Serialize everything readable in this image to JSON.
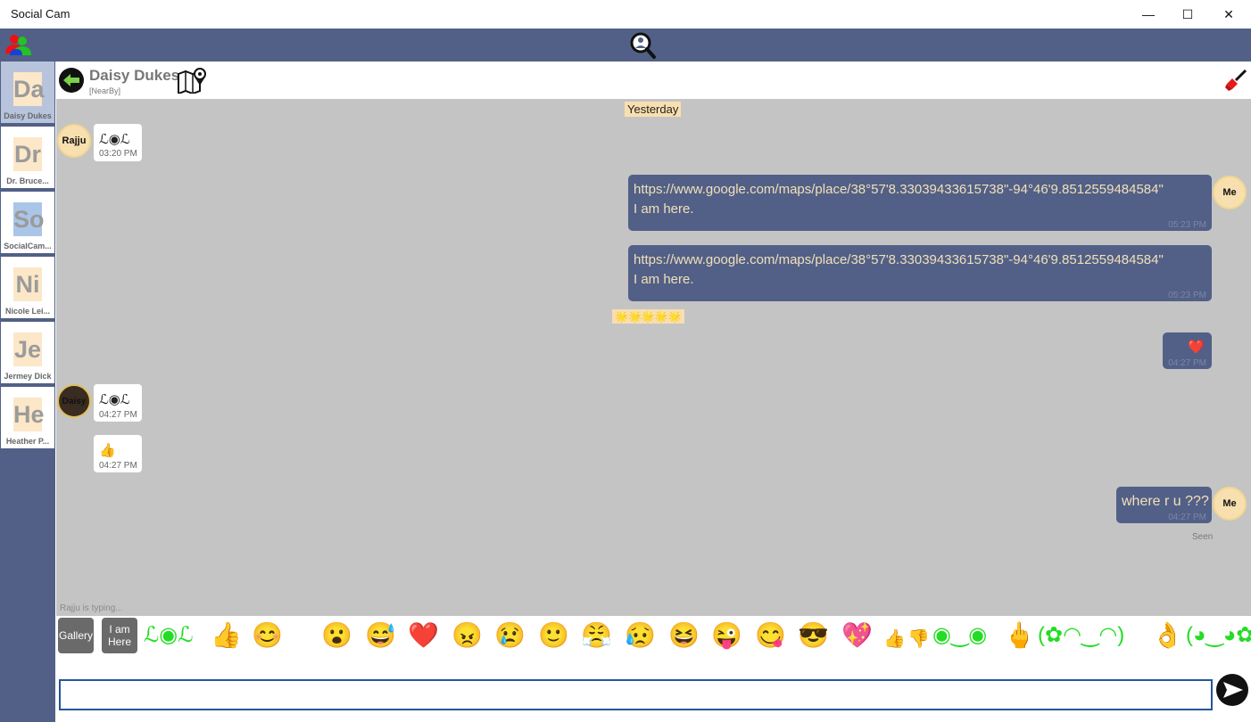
{
  "window": {
    "title": "Social Cam",
    "minimize": "—",
    "maximize": "☐",
    "close": "✕"
  },
  "sidebar": {
    "contacts": [
      {
        "initials": "Da",
        "name": "Daisy Dukes"
      },
      {
        "initials": "Dr",
        "name": "Dr. Bruce..."
      },
      {
        "initials": "So",
        "name": "SocialCam..."
      },
      {
        "initials": "Ni",
        "name": "Nicole Lei..."
      },
      {
        "initials": "Je",
        "name": "Jermey Dick"
      },
      {
        "initials": "He",
        "name": "Heather P..."
      }
    ]
  },
  "chat": {
    "name": "Daisy Dukes",
    "status": "[NearBy]",
    "date_divider": "Yesterday",
    "messages": [
      {
        "sender": "Rajju",
        "text": "ℒ◉ℒ",
        "time": "03:20 PM"
      },
      {
        "sender": "Me",
        "link": "https://www.google.com/maps/place/38°57'8.33039433615738\"-94°46'9.8512559484584\"",
        "text": "I am here.",
        "time": "05:23 PM"
      },
      {
        "sender": "Me",
        "link": "https://www.google.com/maps/place/38°57'8.33039433615738\"-94°46'9.8512559484584\"",
        "text": "I am here.",
        "time": "05:23 PM"
      },
      {
        "sender": "system",
        "text": "🌟🌟🌟🌟🌟"
      },
      {
        "sender": "Me",
        "text": "❤️",
        "time": "04:27 PM"
      },
      {
        "sender": "Daisy",
        "text": "ℒ◉ℒ",
        "time": "04:27 PM"
      },
      {
        "sender": "Daisy",
        "text": "👍",
        "time": "04:27 PM"
      },
      {
        "sender": "Me",
        "text": "where r u ???",
        "time": "04:27 PM"
      }
    ],
    "seen": "Seen",
    "typing": "Rajju  is typing..."
  },
  "avatars": {
    "rajju": "Rajju",
    "me": "Me",
    "daisy": "Daisy"
  },
  "emoji_bar": {
    "gallery": "Gallery",
    "iamhere": "I am Here",
    "items": [
      "ℒ◉ℒ",
      "👍",
      "😊",
      "😮",
      "😅",
      "❤️",
      "😠",
      "😢",
      "🙂",
      "😤",
      "😥",
      "😆",
      "😜",
      "😋",
      "😎",
      "💖",
      "👍",
      "👎",
      "◉‿◉",
      "🖕",
      "(✿◠‿◠)",
      "👌",
      "(◕‿◕✿"
    ]
  },
  "input": {
    "value": ""
  }
}
